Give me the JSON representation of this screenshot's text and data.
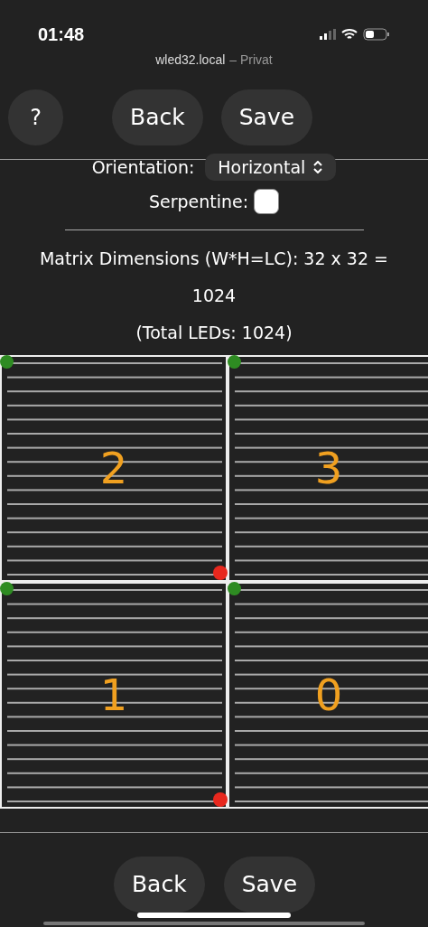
{
  "status_bar": {
    "time": "01:48"
  },
  "address": {
    "host": "wled32.local",
    "mode": "– Privat"
  },
  "top_buttons": [
    {
      "kind": "round",
      "label": "?"
    },
    {
      "kind": "pill",
      "label": "Back"
    },
    {
      "kind": "pill",
      "label": "Save"
    }
  ],
  "orientation": {
    "label": "Orientation:",
    "value": "Horizontal"
  },
  "serpentine": {
    "label": "Serpentine:",
    "checked": false
  },
  "dimensions": "Matrix Dimensions (W*H=LC): 32 x 32 = 1024",
  "total": "(Total LEDs: 1024)",
  "panels": [
    {
      "label": "2",
      "end_visible": true
    },
    {
      "label": "3",
      "end_visible": false
    },
    {
      "label": "1",
      "end_visible": true
    },
    {
      "label": "0",
      "end_visible": false
    }
  ],
  "bottom_buttons": [
    {
      "label": "Back"
    },
    {
      "label": "Save"
    }
  ]
}
